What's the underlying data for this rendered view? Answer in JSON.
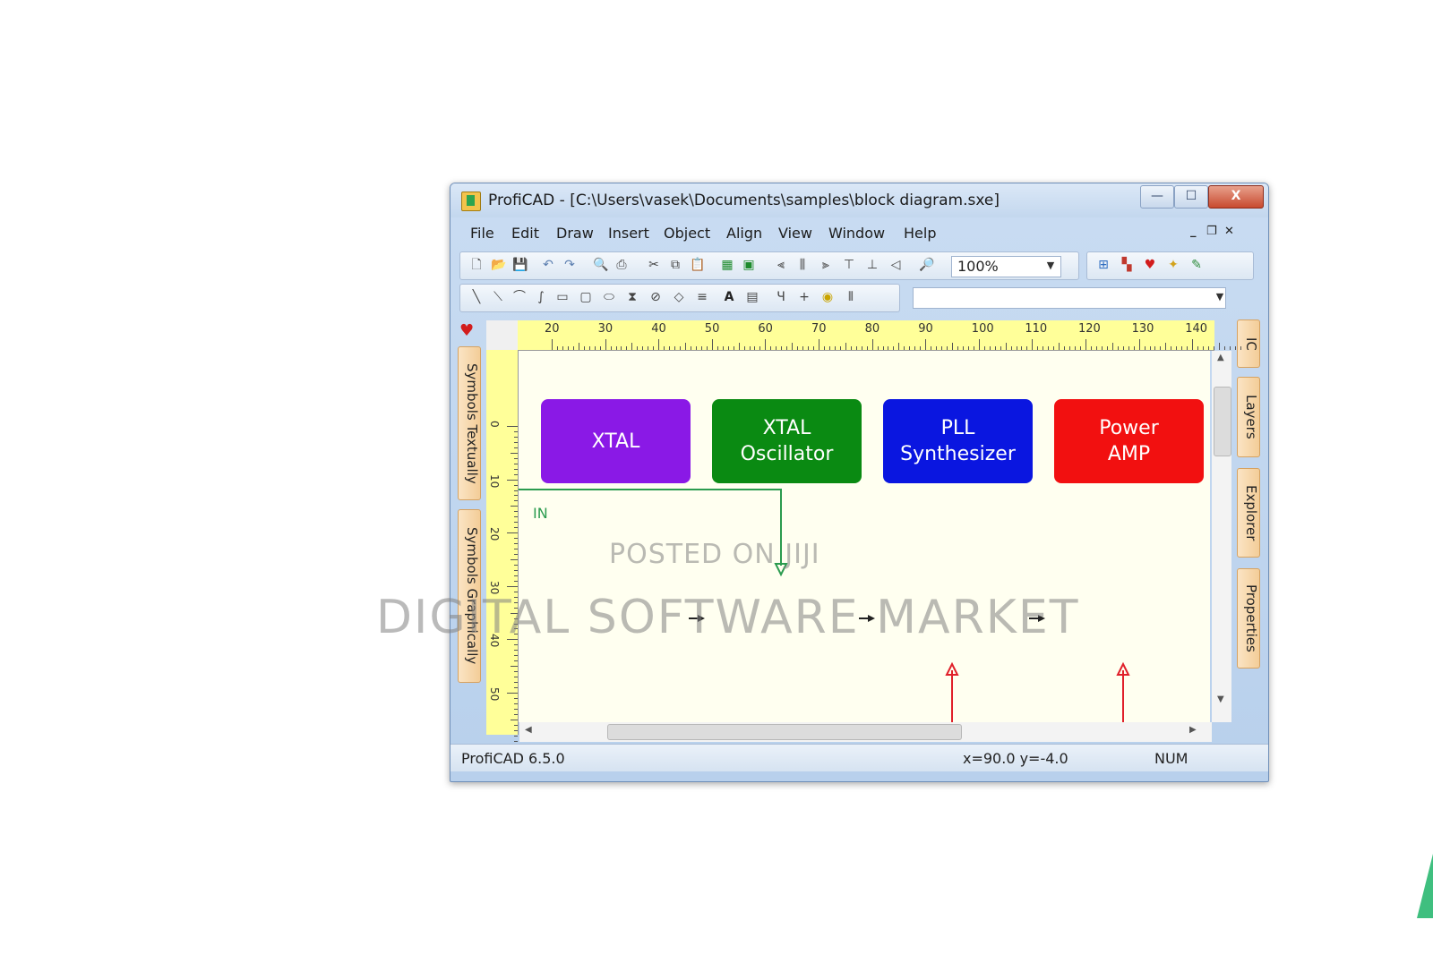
{
  "window": {
    "title": "ProfiCAD - [C:\\Users\\vasek\\Documents\\samples\\block diagram.sxe]",
    "minimize": "—",
    "maximize": "☐",
    "close": "X"
  },
  "menu": {
    "items": [
      "File",
      "Edit",
      "Draw",
      "Insert",
      "Object",
      "Align",
      "View",
      "Window",
      "Help"
    ],
    "mdi_minimize": "_",
    "mdi_restore": "❐",
    "mdi_close": "✕"
  },
  "toolbar": {
    "zoom_value": "100%",
    "combo_value": ""
  },
  "left_tabs": {
    "textual": "Symbols Textually",
    "graphical": "Symbols Graphically"
  },
  "right_tabs": {
    "ic": "IC",
    "layers": "Layers",
    "explorer": "Explorer",
    "properties": "Properties"
  },
  "ruler": {
    "top_labels": [
      "20",
      "30",
      "40",
      "50",
      "60",
      "70",
      "80",
      "90",
      "100",
      "110",
      "120",
      "130",
      "140"
    ],
    "left_labels": [
      "0",
      "10",
      "20",
      "30",
      "40",
      "50"
    ]
  },
  "diagram": {
    "in_label": "IN",
    "blocks": [
      {
        "line1": "XTAL",
        "line2": "",
        "color": "#8a19e6"
      },
      {
        "line1": "XTAL",
        "line2": "Oscillator",
        "color": "#0a8a12"
      },
      {
        "line1": "PLL",
        "line2": "Synthesizer",
        "color": "#0a16e0"
      },
      {
        "line1": "Power",
        "line2": "AMP",
        "color": "#f21010"
      }
    ]
  },
  "status": {
    "version": "ProfiCAD 6.5.0",
    "coords": "x=90.0  y=-4.0",
    "numlock": "NUM"
  },
  "watermark": {
    "line1": "POSTED ON JIJI",
    "line2": "DIGITAL SOFTWARE MARKET"
  }
}
